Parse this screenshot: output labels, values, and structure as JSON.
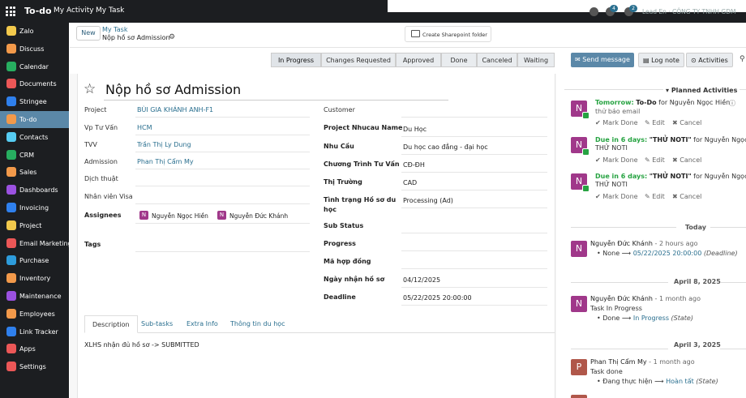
{
  "topbar": {
    "app_name": "To-do",
    "nav": [
      "My Activity",
      "My Task"
    ],
    "badges": [
      "4",
      "2"
    ],
    "user": "Lead En · CÔNG TY TNHH GDM"
  },
  "sidebar": {
    "items": [
      {
        "label": "Zalo",
        "color": "#f2c94c"
      },
      {
        "label": "Discuss",
        "color": "#f2994a"
      },
      {
        "label": "Calendar",
        "color": "#27ae60"
      },
      {
        "label": "Documents",
        "color": "#eb5757"
      },
      {
        "label": "Stringee",
        "color": "#2f80ed"
      },
      {
        "label": "To-do",
        "color": "#f2994a"
      },
      {
        "label": "Contacts",
        "color": "#56ccf2"
      },
      {
        "label": "CRM",
        "color": "#27ae60"
      },
      {
        "label": "Sales",
        "color": "#f2994a"
      },
      {
        "label": "Dashboards",
        "color": "#9b51e0"
      },
      {
        "label": "Invoicing",
        "color": "#2f80ed"
      },
      {
        "label": "Project",
        "color": "#f2c94c"
      },
      {
        "label": "Email Marketing",
        "color": "#eb5757"
      },
      {
        "label": "Purchase",
        "color": "#2d9cdb"
      },
      {
        "label": "Inventory",
        "color": "#f2994a"
      },
      {
        "label": "Maintenance",
        "color": "#9b51e0"
      },
      {
        "label": "Employees",
        "color": "#f2994a"
      },
      {
        "label": "Link Tracker",
        "color": "#2f80ed"
      },
      {
        "label": "Apps",
        "color": "#eb5757"
      },
      {
        "label": "Settings",
        "color": "#eb5757"
      }
    ]
  },
  "control": {
    "new_label": "New",
    "breadcrumb_parent": "My Task",
    "breadcrumb_current": "Nộp hồ sơ Admission",
    "sharepoint_label": "Create Sharepoint folder"
  },
  "stages": [
    "In Progress",
    "Changes Requested",
    "Approved",
    "Done",
    "Canceled",
    "Waiting"
  ],
  "form": {
    "title": "Nộp hồ sơ Admission",
    "left": [
      {
        "label": "Project",
        "value": "BÙI GIA KHÁNH ANH-F1"
      },
      {
        "label": "Vp Tư Vấn",
        "value": "HCM"
      },
      {
        "label": "TVV",
        "value": "Trần Thị Ly Dung"
      },
      {
        "label": "Admission",
        "value": "Phan Thị Cẩm My"
      },
      {
        "label": "Dịch thuật",
        "value": ""
      },
      {
        "label": "Nhân viên Visa",
        "value": ""
      }
    ],
    "assignees_label": "Assignees",
    "assignees": [
      "Nguyễn Ngọc Hiền",
      "Nguyễn Đức Khánh"
    ],
    "tags_label": "Tags",
    "right": [
      {
        "label": "Customer",
        "value": ""
      },
      {
        "label": "Project Nhucau Name",
        "value": "Du Học"
      },
      {
        "label": "Nhu Cầu",
        "value": "Du học cao đẳng - đại học"
      },
      {
        "label": "Chương Trình Tư Vấn",
        "value": "CĐ-ĐH"
      },
      {
        "label": "Thị Trường",
        "value": "CAD"
      },
      {
        "label": "Tình trạng Hồ sơ du",
        "label2": "học",
        "value": "Processing (Ad)"
      },
      {
        "label": "Sub Status",
        "value": ""
      },
      {
        "label": "Progress",
        "value": ""
      },
      {
        "label": "Mã hợp đồng",
        "value": ""
      },
      {
        "label": "Ngày nhận hồ sơ",
        "value": "04/12/2025"
      },
      {
        "label": "Deadline",
        "value": "05/22/2025 20:00:00"
      }
    ],
    "tabs": [
      "Description",
      "Sub-tasks",
      "Extra Info",
      "Thông tin du học"
    ],
    "description": "XLHS nhận đủ hồ sơ -> SUBMITTED"
  },
  "chatter": {
    "send_label": "Send message",
    "note_label": "Log note",
    "activities_label": "Activities",
    "planned_label": "Planned Activities",
    "planned": [
      {
        "due": "Tomorrow:",
        "title": "To-Do",
        "for": "for Nguyễn Ngọc Hiền",
        "extra": "thử báo email"
      },
      {
        "due": "Due in 6 days:",
        "title": "\"THỬ NOTI\"",
        "for": "for Nguyễn Ngọc Hi",
        "extra": "THỬ NOTI"
      },
      {
        "due": "Due in 6 days:",
        "title": "\"THỬ NOTI\"",
        "for": "for Nguyễn Ngọc Hi",
        "extra": "THỬ NOTI"
      }
    ],
    "actions": {
      "done": "Mark Done",
      "edit": "Edit",
      "cancel": "Cancel"
    },
    "today_label": "Today",
    "date1": "April 8, 2025",
    "date2": "April 3, 2025",
    "messages": [
      {
        "author": "Nguyễn Đức Khánh",
        "time": "- 2 hours ago",
        "line": "",
        "from": "None",
        "to": "05/22/2025 20:00:00",
        "field": "(Deadline)",
        "initial": "N",
        "color": "#a0388a"
      },
      {
        "author": "Nguyễn Đức Khánh",
        "time": "- 1 month ago",
        "line": "Task In Progress",
        "from": "Done",
        "to": "In Progress",
        "field": "(State)",
        "initial": "N",
        "color": "#a0388a"
      },
      {
        "author": "Phan Thị Cẩm My",
        "time": "- 1 month ago",
        "line": "Task done",
        "from": "Đang thực hiện",
        "to": "Hoàn tất",
        "field": "(State)",
        "initial": "P",
        "color": "#b0574a"
      }
    ]
  }
}
